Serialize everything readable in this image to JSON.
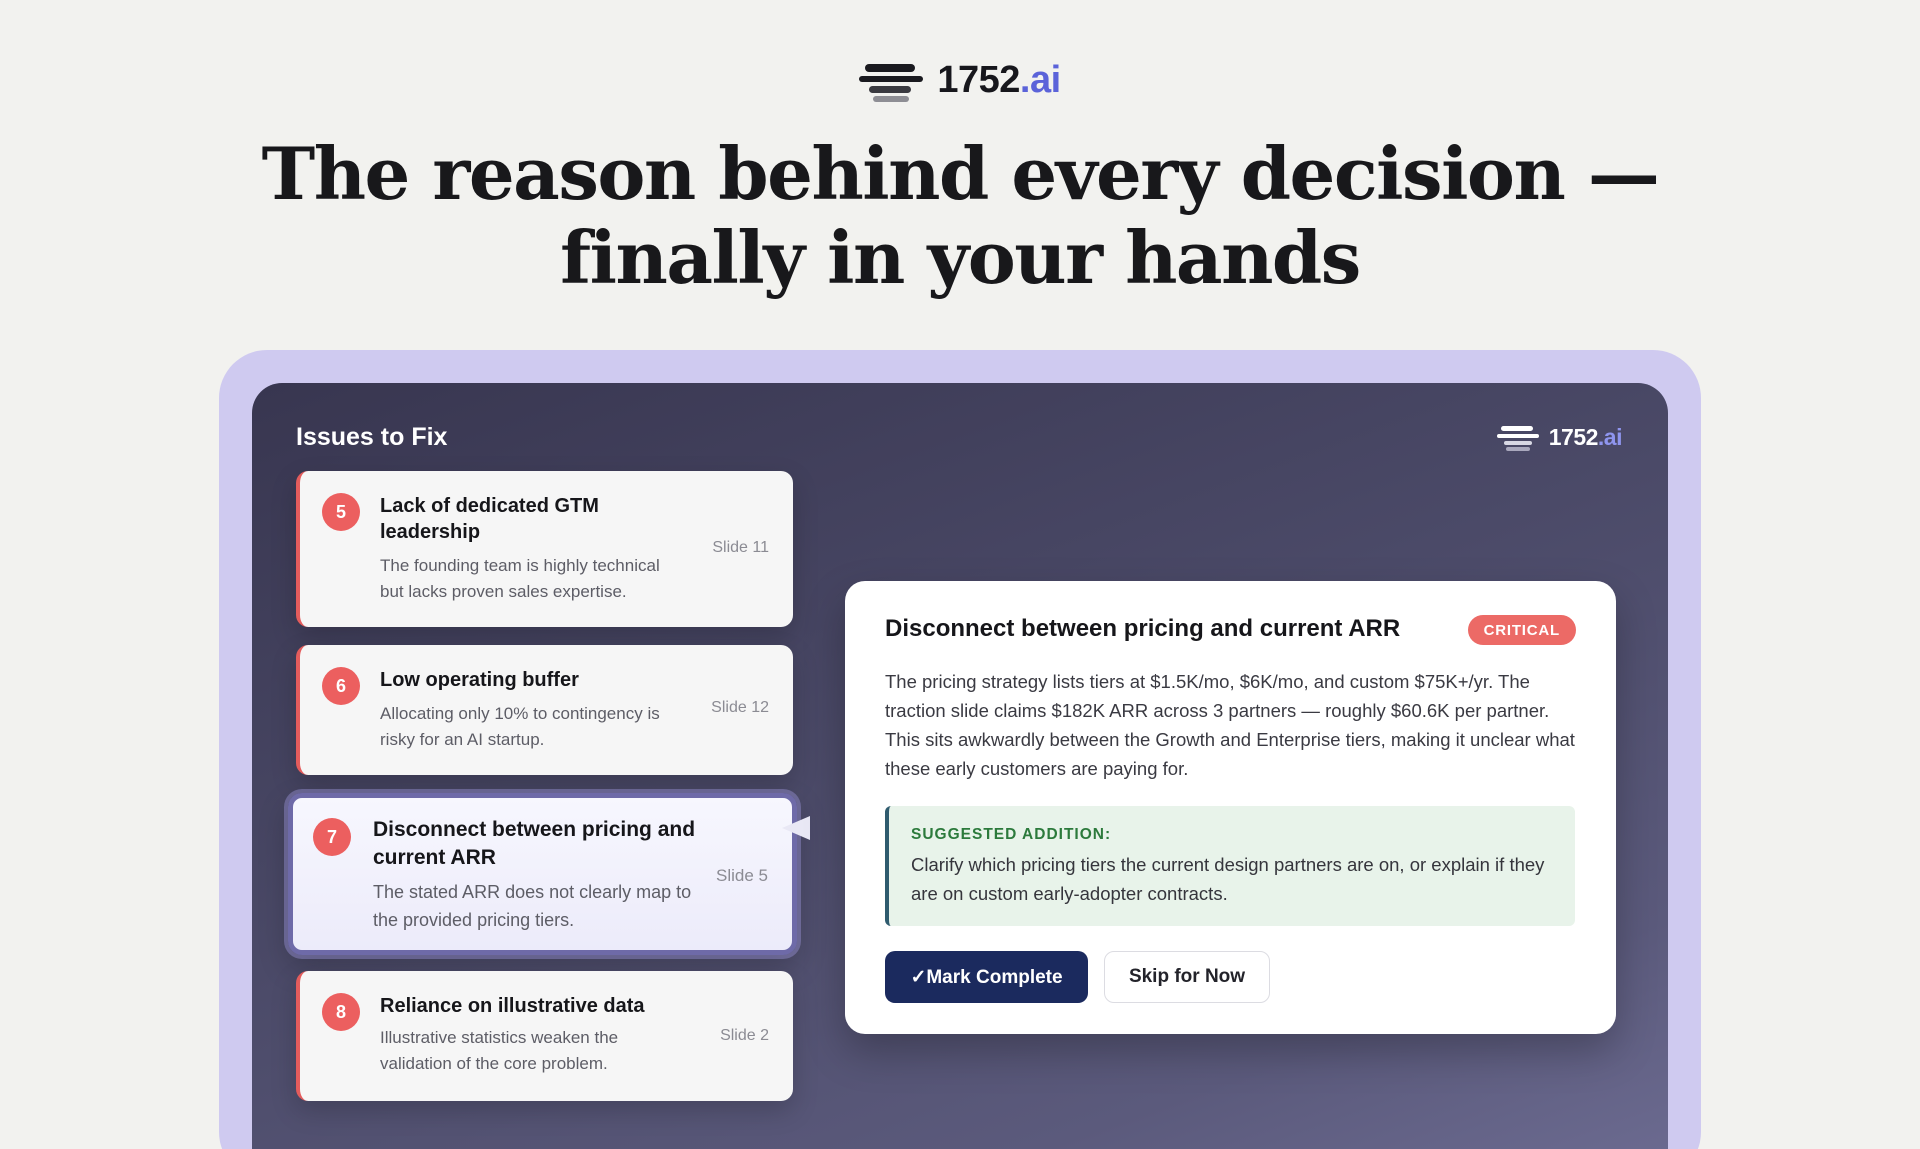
{
  "brand": {
    "name": "1752",
    "suffix": ".ai"
  },
  "headline": {
    "line1": "The reason behind every decision —",
    "line2": "finally in your hands"
  },
  "panel": {
    "title": "Issues to Fix",
    "brand": {
      "name": "1752",
      "suffix": ".ai"
    }
  },
  "issues": [
    {
      "number": "5",
      "title": "Lack of dedicated GTM leadership",
      "description": "The founding team is highly technical but lacks proven sales expertise.",
      "slide": "Slide 11"
    },
    {
      "number": "6",
      "title": "Low operating buffer",
      "description": "Allocating only 10% to contingency is risky for an AI startup.",
      "slide": "Slide 12"
    },
    {
      "number": "7",
      "title": "Disconnect between pricing and current ARR",
      "description": "The stated ARR does not clearly map to the provided pricing tiers.",
      "slide": "Slide 5",
      "selected": true
    },
    {
      "number": "8",
      "title": "Reliance on illustrative data",
      "description": "Illustrative statistics weaken the validation of the core problem.",
      "slide": "Slide 2"
    }
  ],
  "detail": {
    "title": "Disconnect between pricing and current ARR",
    "severity": "CRITICAL",
    "body": "The pricing strategy lists tiers at $1.5K/mo, $6K/mo, and custom $75K+/yr. The traction slide claims $182K ARR across 3 partners — roughly $60.6K per partner. This sits awkwardly between the Growth and Enterprise tiers, making it unclear what these early customers are paying for.",
    "suggestion_label": "SUGGESTED ADDITION:",
    "suggestion_text": "Clarify which pricing tiers the current design partners are on, or explain if they are on custom early-adopter contracts.",
    "mark_complete_label": "✓Mark Complete",
    "skip_label": "Skip for Now"
  },
  "colors": {
    "accent": "#5b63d9",
    "critical": "#ec6a66",
    "primary_button": "#1b2a5e",
    "frame": "#cfcaf0",
    "suggestion_bg": "#e8f3ea",
    "suggestion_label": "#2c7a3c"
  }
}
